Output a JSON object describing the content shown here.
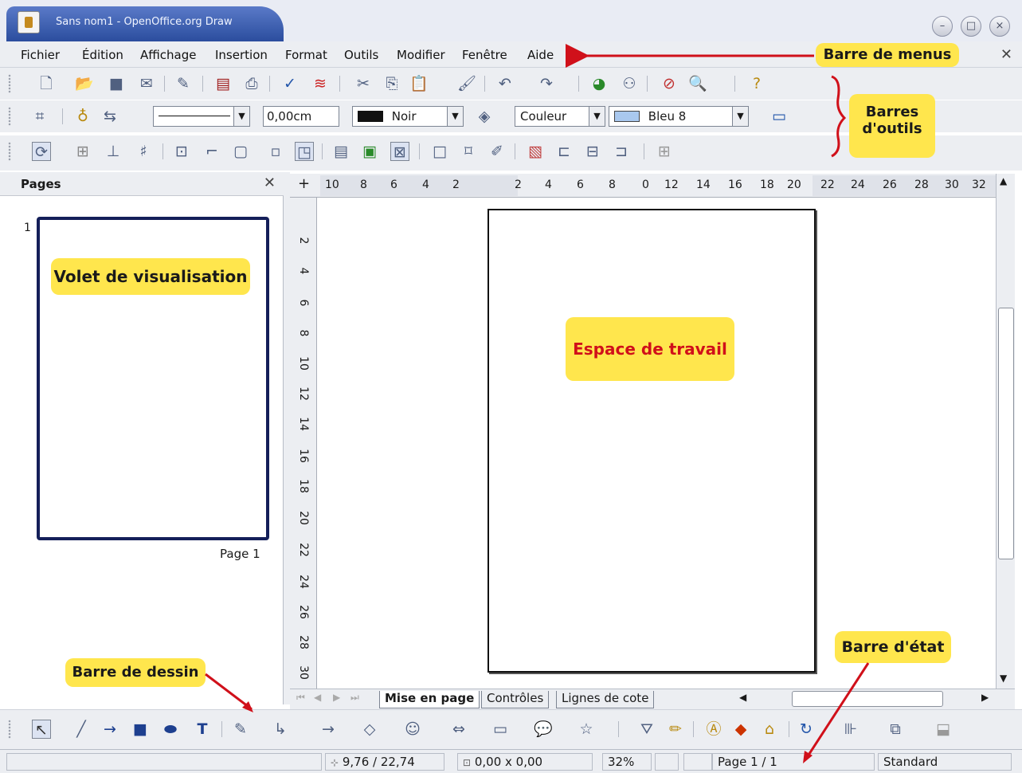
{
  "window": {
    "title": "Sans nom1 - OpenOffice.org Draw"
  },
  "menu": {
    "items": [
      "Fichier",
      "Édition",
      "Affichage",
      "Insertion",
      "Format",
      "Outils",
      "Modifier",
      "Fenêtre",
      "Aide"
    ]
  },
  "toolbar_line": {
    "line_width": "0,00cm",
    "line_color": "Noir",
    "area_style": "Couleur",
    "area_color": "Bleu 8"
  },
  "pages_pane": {
    "title": "Pages",
    "thumb_number": "1",
    "thumb_label": "Page 1"
  },
  "ruler_h": {
    "left_ticks": [
      "10",
      "8",
      "6",
      "4",
      "2"
    ],
    "mid_ticks": [
      "2",
      "4",
      "6",
      "8",
      "0",
      "12",
      "14",
      "16",
      "18",
      "20"
    ],
    "right_ticks": [
      "22",
      "24",
      "26",
      "28",
      "30",
      "32"
    ]
  },
  "ruler_v": {
    "ticks": [
      "2",
      "4",
      "6",
      "8",
      "10",
      "12",
      "14",
      "16",
      "18",
      "20",
      "22",
      "24",
      "26",
      "28",
      "30"
    ]
  },
  "tabs": [
    "Mise en page",
    "Contrôles",
    "Lignes de cote"
  ],
  "status": {
    "position": "9,76 / 22,74",
    "size": "0,00 x 0,00",
    "zoom": "32%",
    "page": "Page 1 / 1",
    "style": "Standard"
  },
  "callouts": {
    "menubar": "Barre de menus",
    "toolbars_1": "Barres",
    "toolbars_2": "d'outils",
    "preview": "Volet de visualisation",
    "workspace": "Espace de travail",
    "drawbar": "Barre de dessin",
    "statusbar": "Barre d'état"
  },
  "colors": {
    "callout": "#ffe64d",
    "annotation": "#d0101a",
    "thumb_border": "#141f59",
    "title_active": "#2b4d9e"
  }
}
